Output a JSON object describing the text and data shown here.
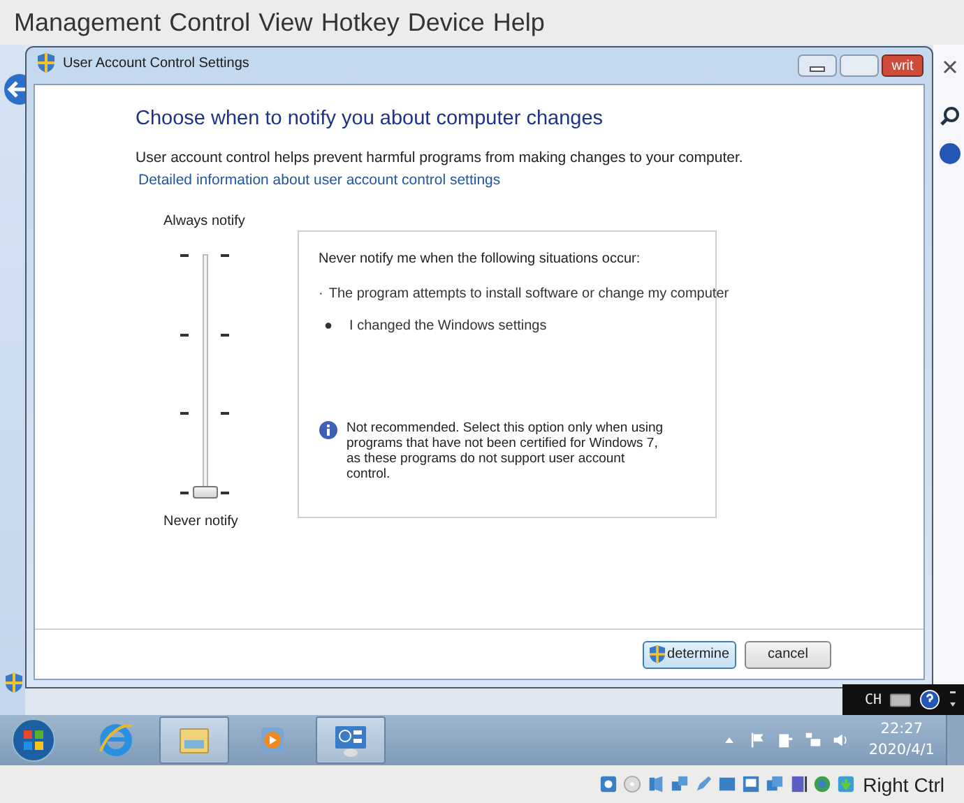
{
  "menu_bar": {
    "items": [
      "Management",
      "Control",
      "View",
      "Hotkey",
      "Device",
      "Help"
    ]
  },
  "dialog": {
    "title": "User Account Control Settings",
    "close_label": "writ",
    "heading": "Choose when to notify you about computer changes",
    "description": "User account control helps prevent harmful programs from making changes to your computer.",
    "link": "Detailed information about user account control settings",
    "slider": {
      "top_label": "Always notify",
      "bottom_label": "Never notify",
      "level": 0
    },
    "info_panel": {
      "title": "Never notify me when the following situations occur:",
      "bullets": [
        {
          "marker": "·",
          "text": "The program attempts to install software or change my computer"
        },
        {
          "marker": "●",
          "text": "I changed the Windows settings"
        }
      ],
      "note": "Not recommended. Select this option only when using programs that have not been certified for Windows 7, as these programs do not support user account control."
    },
    "buttons": [
      {
        "label": "determine",
        "kind": "shield",
        "selected": true
      },
      {
        "label": "cancel",
        "kind": "plain",
        "selected": false
      }
    ]
  },
  "taskbar": {
    "apps": [
      {
        "kind": "ie",
        "active": false
      },
      {
        "kind": "explorer",
        "active": true
      },
      {
        "kind": "media",
        "active": false
      },
      {
        "kind": "control",
        "active": true
      }
    ],
    "time": "22:27",
    "date": "2020/4/1"
  },
  "language_bar": {
    "label": "CH"
  },
  "vm_status": {
    "host_key": "Right Ctrl"
  }
}
